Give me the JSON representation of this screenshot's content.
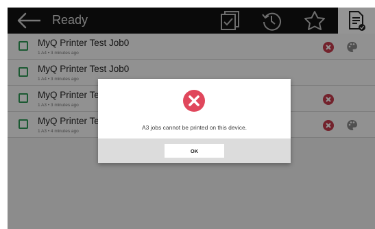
{
  "header": {
    "title": "Ready"
  },
  "jobs": [
    {
      "name": "MyQ Printer Test Job0",
      "meta": "1 A4 • 3 minutes ago",
      "has_x": true,
      "has_palette": true
    },
    {
      "name": "MyQ Printer Test Job0",
      "meta": "1 A4 • 3 minutes ago",
      "has_x": false,
      "has_palette": false
    },
    {
      "name": "MyQ Printer Te",
      "meta": "1 A3 • 3 minutes ago",
      "has_x": true,
      "has_palette": false
    },
    {
      "name": "MyQ Printer Te",
      "meta": "1 A3 • 4 minutes ago",
      "has_x": true,
      "has_palette": true
    }
  ],
  "dialog": {
    "message": "A3 jobs cannot be printed on this device.",
    "ok_label": "OK",
    "icon": "error-x-icon"
  },
  "colors": {
    "topbar": "#121212",
    "accent_green": "#2f9a57",
    "error_red": "#e0475c",
    "row_x": "#c63b4d"
  },
  "icons": {
    "back": "arrow-left-icon",
    "toolbar": [
      "checkbox-doc-icon",
      "history-icon",
      "star-icon",
      "document-check-icon"
    ]
  }
}
